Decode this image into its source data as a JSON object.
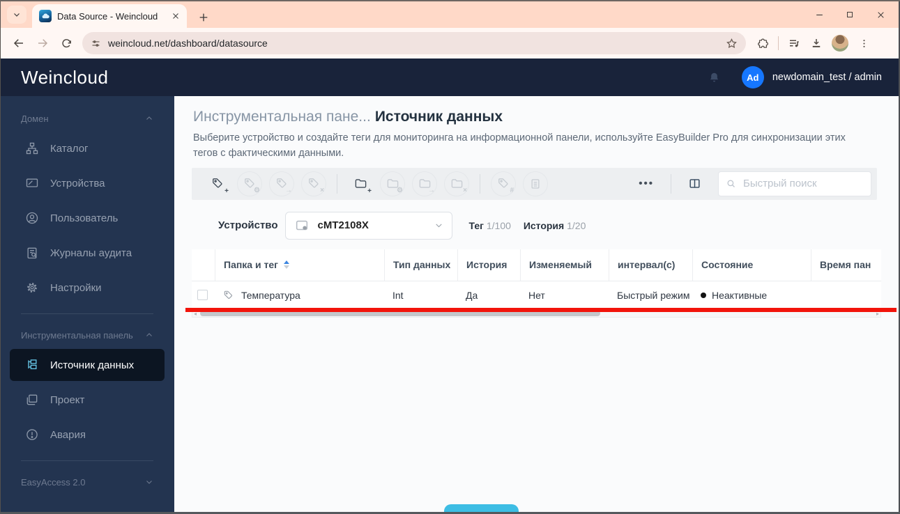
{
  "browser": {
    "tab_title": "Data Source - Weincloud",
    "url": "weincloud.net/dashboard/datasource"
  },
  "app_header": {
    "logo": "Weincloud",
    "avatar": "Ad",
    "username": "newdomain_test / admin"
  },
  "sidebar": {
    "sections": [
      {
        "label": "Домен",
        "items": [
          {
            "label": "Каталог"
          },
          {
            "label": "Устройства"
          },
          {
            "label": "Пользователь"
          },
          {
            "label": "Журналы аудита"
          },
          {
            "label": "Настройки"
          }
        ]
      },
      {
        "label": "Инструментальная панель",
        "items": [
          {
            "label": "Источник данных",
            "active": true
          },
          {
            "label": "Проект"
          },
          {
            "label": "Авария"
          }
        ]
      },
      {
        "label": "EasyAccess 2.0",
        "items": []
      }
    ]
  },
  "page": {
    "breadcrumb": "Инструментальная пане...",
    "title": "Источник данных",
    "description": "Выберите устройство и создайте теги для мониторинга на информационной панели, используйте EasyBuilder Pro для синхронизации этих тегов с фактическими данными."
  },
  "toolbar": {
    "more_icon": "•••",
    "search_placeholder": "Быстрый поиск"
  },
  "device_bar": {
    "label": "Устройство",
    "device_name": "cMT2108X",
    "tag_label": "Тег",
    "tag_count": "1/100",
    "history_label": "История",
    "history_count": "1/20"
  },
  "table": {
    "columns": [
      "Папка и тег",
      "Тип данных",
      "История",
      "Изменяемый",
      "интервал(с)",
      "Состояние",
      "Время пан"
    ],
    "rows": [
      {
        "name": "Температура",
        "type": "Int",
        "history": "Да",
        "editable": "Нет",
        "interval": "Быстрый режим",
        "state": "Неактивные"
      }
    ]
  },
  "colors": {
    "annotation_red": "#f2140b",
    "bottom_button_cyan": "#3dbde4",
    "avatar_blue": "#1677ff",
    "active_icon_cyan": "#67c7e8",
    "header_navy": "#19233a",
    "sidebar_navy": "#233450",
    "browser_tabstrip_peach": "#ffd9c8"
  }
}
